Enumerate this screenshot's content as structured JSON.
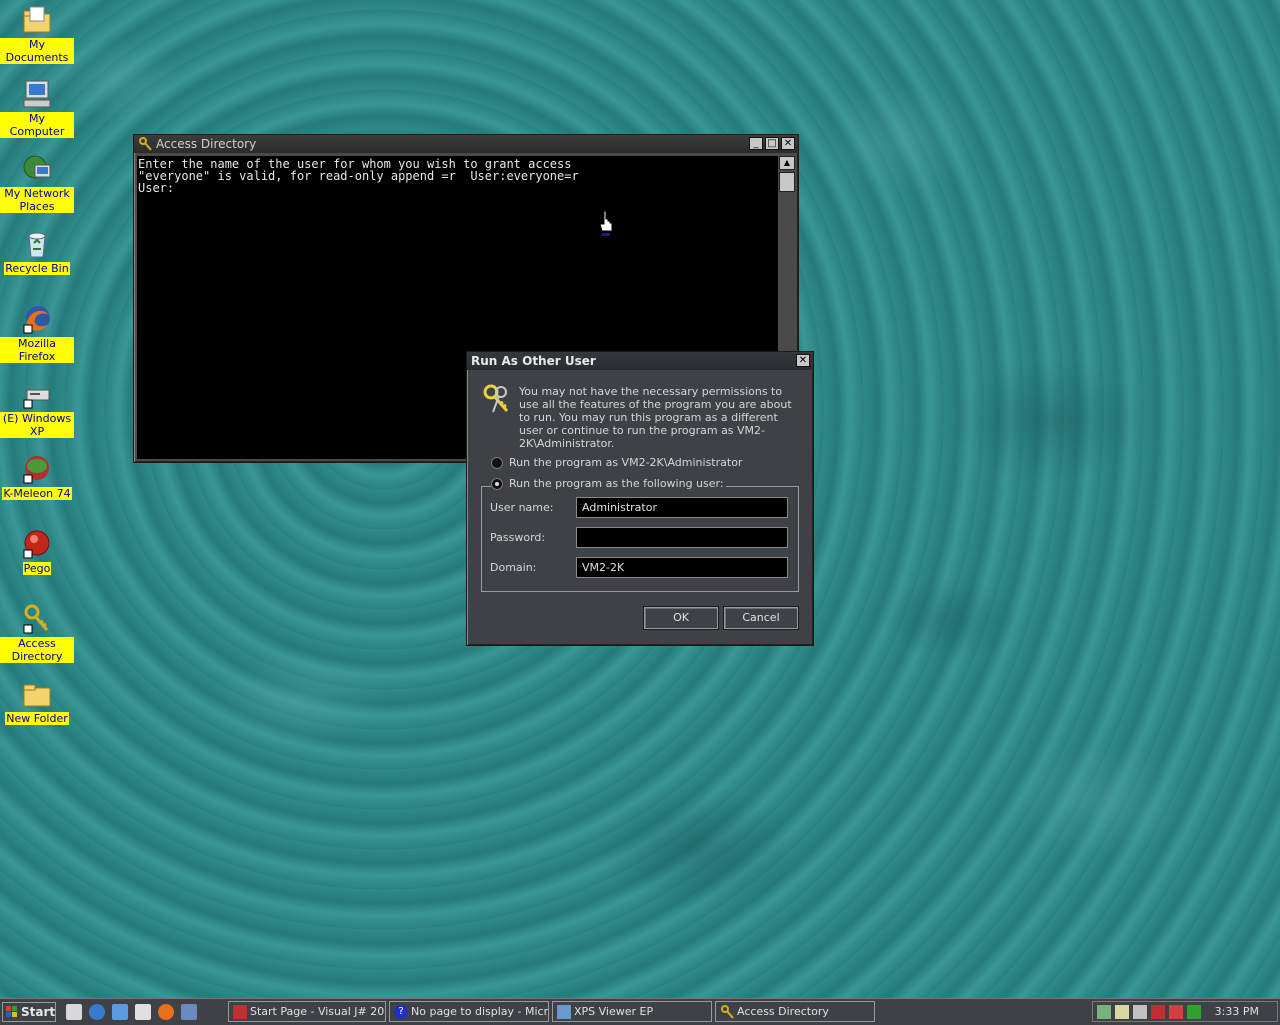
{
  "desktop": {
    "icons": [
      {
        "label": "My Documents"
      },
      {
        "label": "My Computer"
      },
      {
        "label": "My Network Places"
      },
      {
        "label": "Recycle Bin"
      },
      {
        "label": "Mozilla Firefox"
      },
      {
        "label": "(E) Windows XP"
      },
      {
        "label": "K-Meleon 74"
      },
      {
        "label": "Pego"
      },
      {
        "label": "Access Directory"
      },
      {
        "label": "New Folder"
      }
    ]
  },
  "console_window": {
    "title": "Access Directory",
    "lines": [
      "Enter the name of the user for whom you wish to grant access",
      "\"everyone\" is valid, for read-only append =r  User:everyone=r",
      "User:"
    ]
  },
  "run_as_dialog": {
    "title": "Run As Other User",
    "message": "You may not have the necessary permissions to use all the features of the program you are about to run.  You may run this program as a different user or continue to run the program as VM2-2K\\Administrator.",
    "option_current": "Run the program as VM2-2K\\Administrator",
    "option_other": "Run the program as the following user:",
    "selected_option": "option_other",
    "username_label": "User name:",
    "username_value": "Administrator",
    "password_label": "Password:",
    "password_value": "",
    "domain_label": "Domain:",
    "domain_value": "VM2-2K",
    "ok_label": "OK",
    "cancel_label": "Cancel"
  },
  "taskbar": {
    "start_label": "Start",
    "tasks": [
      {
        "label": "Start Page - Visual J# 20..."
      },
      {
        "label": "No page to display - Micro..."
      },
      {
        "label": "XPS Viewer EP"
      },
      {
        "label": "Access Directory"
      }
    ],
    "clock": "3:33 PM"
  },
  "colors": {
    "desktop_teal": "#2d8585",
    "icon_label_bg": "#ffff00",
    "icon_label_text": "#0000a0",
    "window_chrome": "#3e4246"
  }
}
